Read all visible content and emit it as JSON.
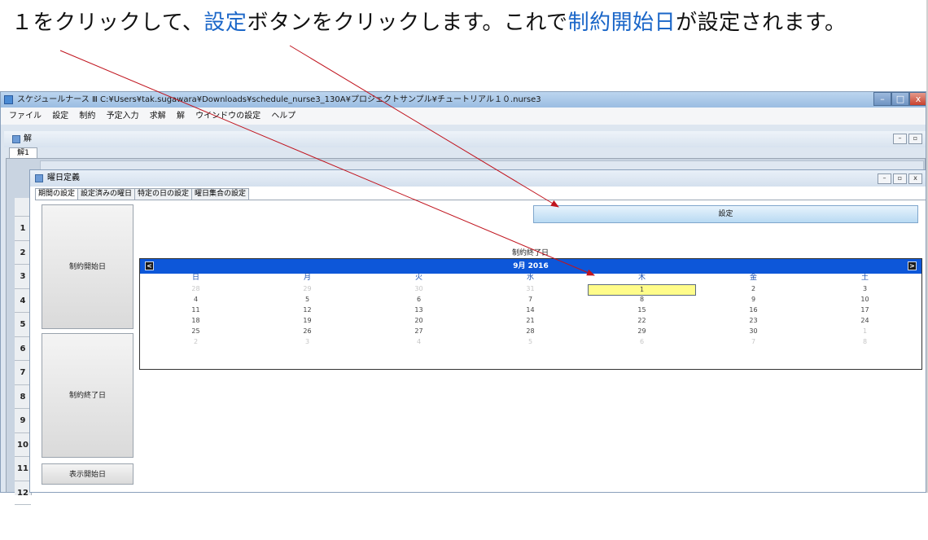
{
  "caption": {
    "part1": "１をクリックして、",
    "part2": "設定",
    "part3": "ボタンをクリックします。これで",
    "part4": "制約開始日",
    "part5": "が設定されます。"
  },
  "window": {
    "title": "スケジュールナース Ⅲ   C:¥Users¥tak.sugawara¥Downloads¥schedule_nurse3_130A¥プロジェクトサンプル¥チュートリアル１０.nurse3",
    "min_glyph": "–",
    "max_glyph": "□",
    "close_glyph": "x"
  },
  "menu": [
    "ファイル",
    "設定",
    "制約",
    "予定入力",
    "求解",
    "解",
    "ウインドウの設定",
    "ヘルプ"
  ],
  "child": {
    "title": "解",
    "tab": "解1"
  },
  "row_numbers": [
    "1",
    "2",
    "3",
    "4",
    "5",
    "6",
    "7",
    "8",
    "9",
    "10",
    "11",
    "12"
  ],
  "dialog": {
    "title": "曜日定義",
    "tabs": [
      "期間の設定",
      "設定済みの曜日",
      "特定の日の設定",
      "曜日集合の設定"
    ],
    "side_buttons": [
      "制約開始日",
      "制約終了日",
      "表示開始日"
    ],
    "set_button": "設定",
    "calendar_label": "制約終了日"
  },
  "calendar": {
    "month": "9月 2016",
    "prev_glyph": "<",
    "next_glyph": ">",
    "weekdays": [
      "日",
      "月",
      "火",
      "水",
      "木",
      "金",
      "土"
    ],
    "weeks": [
      [
        "28",
        "29",
        "30",
        "31",
        "1",
        "2",
        "3"
      ],
      [
        "4",
        "5",
        "6",
        "7",
        "8",
        "9",
        "10"
      ],
      [
        "11",
        "12",
        "13",
        "14",
        "15",
        "16",
        "17"
      ],
      [
        "18",
        "19",
        "20",
        "21",
        "22",
        "23",
        "24"
      ],
      [
        "25",
        "26",
        "27",
        "28",
        "29",
        "30",
        "1"
      ],
      [
        "2",
        "3",
        "4",
        "5",
        "6",
        "7",
        "8"
      ]
    ],
    "selected": "1",
    "accent": "#0d57d9",
    "highlight": "#fffc8a"
  },
  "colors": {
    "caption_highlight": "#1a66c8",
    "arrow": "#c0141e"
  }
}
